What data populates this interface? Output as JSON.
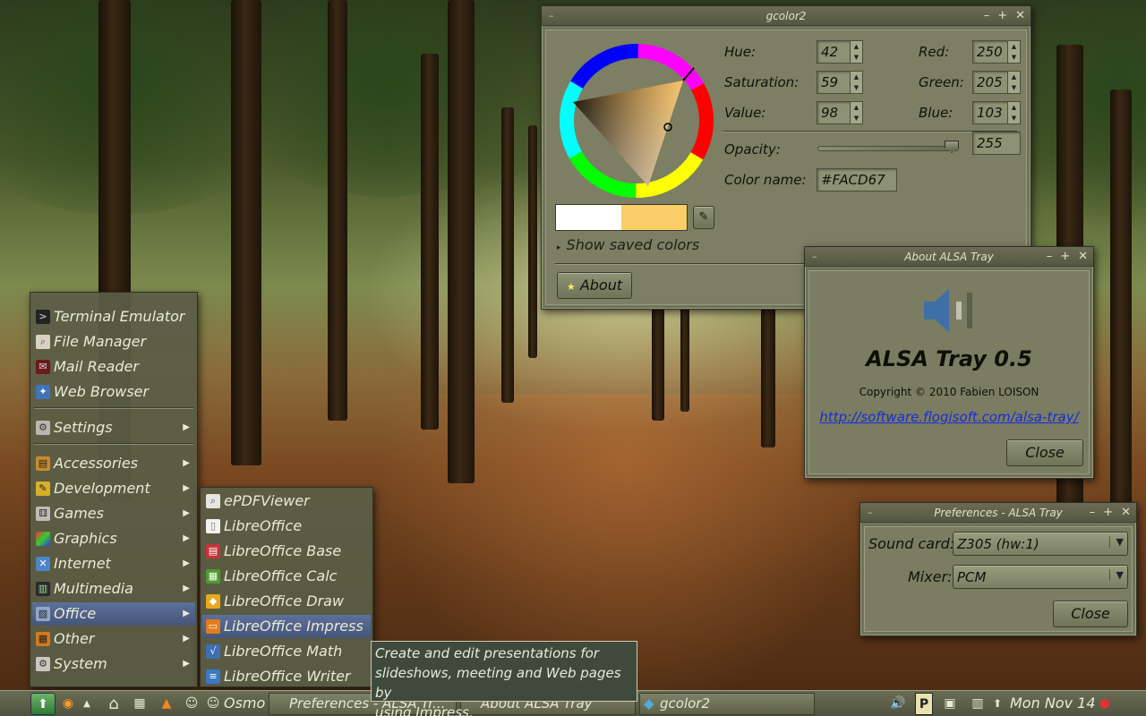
{
  "gcolor2": {
    "title": "gcolor2",
    "hue_label": "Hue:",
    "hue_value": "42",
    "saturation_label": "Saturation:",
    "saturation_value": "59",
    "value_label": "Value:",
    "value_value": "98",
    "red_label": "Red:",
    "red_value": "250",
    "green_label": "Green:",
    "green_value": "205",
    "blue_label": "Blue:",
    "blue_value": "103",
    "opacity_label": "Opacity:",
    "opacity_value": "255",
    "opacity_fraction": 1.0,
    "color_name_label": "Color name:",
    "color_name_value": "#FACD67",
    "previous_color": "#ffffff",
    "current_color": "#facd67",
    "show_saved_label": "Show saved colors",
    "about_label": "About"
  },
  "about_alsa": {
    "title": "About ALSA Tray",
    "app_name": "ALSA Tray 0.5",
    "copyright": "Copyright © 2010 Fabien LOISON",
    "link": "http://software.flogisoft.com/alsa-tray/",
    "close_label": "Close"
  },
  "prefs_alsa": {
    "title": "Preferences - ALSA Tray",
    "sound_card_label": "Sound card:",
    "sound_card_value": "Z305 (hw:1)",
    "mixer_label": "Mixer:",
    "mixer_value": "PCM",
    "close_label": "Close"
  },
  "app_menu": {
    "items": [
      {
        "label": "Terminal Emulator",
        "icon": "terminal-icon"
      },
      {
        "label": "File Manager",
        "icon": "file-manager-icon"
      },
      {
        "label": "Mail Reader",
        "icon": "mail-icon"
      },
      {
        "label": "Web Browser",
        "icon": "web-browser-icon"
      },
      {
        "label": "Settings",
        "icon": "settings-icon"
      },
      {
        "label": "Accessories",
        "icon": "accessories-icon"
      },
      {
        "label": "Development",
        "icon": "development-icon"
      },
      {
        "label": "Games",
        "icon": "games-icon"
      },
      {
        "label": "Graphics",
        "icon": "graphics-icon"
      },
      {
        "label": "Internet",
        "icon": "internet-icon"
      },
      {
        "label": "Multimedia",
        "icon": "multimedia-icon"
      },
      {
        "label": "Office",
        "icon": "office-icon"
      },
      {
        "label": "Other",
        "icon": "other-icon"
      },
      {
        "label": "System",
        "icon": "system-icon"
      }
    ]
  },
  "office_menu": {
    "items": [
      {
        "label": "ePDFViewer",
        "icon": "pdf-viewer-icon"
      },
      {
        "label": "LibreOffice",
        "icon": "libreoffice-icon"
      },
      {
        "label": "LibreOffice Base",
        "icon": "libreoffice-base-icon"
      },
      {
        "label": "LibreOffice Calc",
        "icon": "libreoffice-calc-icon"
      },
      {
        "label": "LibreOffice Draw",
        "icon": "libreoffice-draw-icon"
      },
      {
        "label": "LibreOffice Impress",
        "icon": "libreoffice-impress-icon"
      },
      {
        "label": "LibreOffice Math",
        "icon": "libreoffice-math-icon"
      },
      {
        "label": "LibreOffice Writer",
        "icon": "libreoffice-writer-icon"
      },
      {
        "label": "Osmo",
        "icon": "osmo-icon"
      }
    ]
  },
  "tooltip": {
    "line1": "Create and edit presentations for",
    "line2": "slideshows, meeting and Web pages by",
    "line3": "using Impress."
  },
  "taskbar": {
    "tasks": [
      {
        "label": "Preferences - ALSA Tr..."
      },
      {
        "label": "About ALSA Tray"
      },
      {
        "label": "gcolor2"
      }
    ],
    "clock": "Mon Nov 14"
  }
}
